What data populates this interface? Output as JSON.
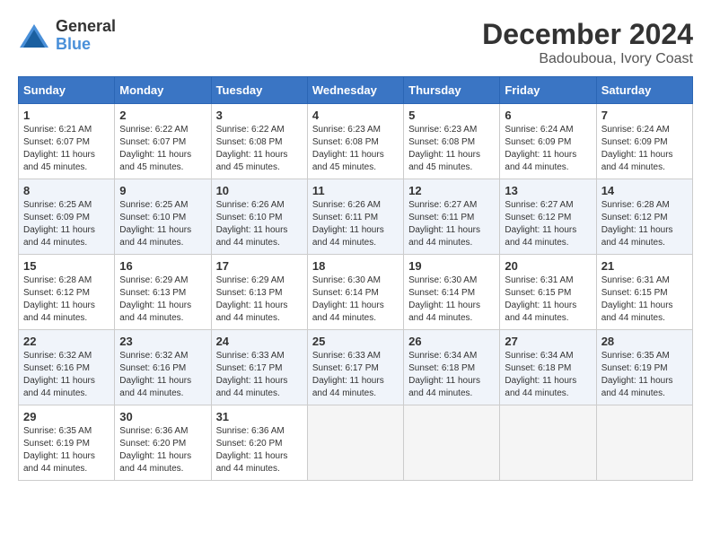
{
  "header": {
    "logo_general": "General",
    "logo_blue": "Blue",
    "month_title": "December 2024",
    "location": "Badouboua, Ivory Coast"
  },
  "days_of_week": [
    "Sunday",
    "Monday",
    "Tuesday",
    "Wednesday",
    "Thursday",
    "Friday",
    "Saturday"
  ],
  "weeks": [
    [
      {
        "day": "1",
        "sunrise": "6:21 AM",
        "sunset": "6:07 PM",
        "daylight": "11 hours and 45 minutes."
      },
      {
        "day": "2",
        "sunrise": "6:22 AM",
        "sunset": "6:07 PM",
        "daylight": "11 hours and 45 minutes."
      },
      {
        "day": "3",
        "sunrise": "6:22 AM",
        "sunset": "6:08 PM",
        "daylight": "11 hours and 45 minutes."
      },
      {
        "day": "4",
        "sunrise": "6:23 AM",
        "sunset": "6:08 PM",
        "daylight": "11 hours and 45 minutes."
      },
      {
        "day": "5",
        "sunrise": "6:23 AM",
        "sunset": "6:08 PM",
        "daylight": "11 hours and 45 minutes."
      },
      {
        "day": "6",
        "sunrise": "6:24 AM",
        "sunset": "6:09 PM",
        "daylight": "11 hours and 44 minutes."
      },
      {
        "day": "7",
        "sunrise": "6:24 AM",
        "sunset": "6:09 PM",
        "daylight": "11 hours and 44 minutes."
      }
    ],
    [
      {
        "day": "8",
        "sunrise": "6:25 AM",
        "sunset": "6:09 PM",
        "daylight": "11 hours and 44 minutes."
      },
      {
        "day": "9",
        "sunrise": "6:25 AM",
        "sunset": "6:10 PM",
        "daylight": "11 hours and 44 minutes."
      },
      {
        "day": "10",
        "sunrise": "6:26 AM",
        "sunset": "6:10 PM",
        "daylight": "11 hours and 44 minutes."
      },
      {
        "day": "11",
        "sunrise": "6:26 AM",
        "sunset": "6:11 PM",
        "daylight": "11 hours and 44 minutes."
      },
      {
        "day": "12",
        "sunrise": "6:27 AM",
        "sunset": "6:11 PM",
        "daylight": "11 hours and 44 minutes."
      },
      {
        "day": "13",
        "sunrise": "6:27 AM",
        "sunset": "6:12 PM",
        "daylight": "11 hours and 44 minutes."
      },
      {
        "day": "14",
        "sunrise": "6:28 AM",
        "sunset": "6:12 PM",
        "daylight": "11 hours and 44 minutes."
      }
    ],
    [
      {
        "day": "15",
        "sunrise": "6:28 AM",
        "sunset": "6:12 PM",
        "daylight": "11 hours and 44 minutes."
      },
      {
        "day": "16",
        "sunrise": "6:29 AM",
        "sunset": "6:13 PM",
        "daylight": "11 hours and 44 minutes."
      },
      {
        "day": "17",
        "sunrise": "6:29 AM",
        "sunset": "6:13 PM",
        "daylight": "11 hours and 44 minutes."
      },
      {
        "day": "18",
        "sunrise": "6:30 AM",
        "sunset": "6:14 PM",
        "daylight": "11 hours and 44 minutes."
      },
      {
        "day": "19",
        "sunrise": "6:30 AM",
        "sunset": "6:14 PM",
        "daylight": "11 hours and 44 minutes."
      },
      {
        "day": "20",
        "sunrise": "6:31 AM",
        "sunset": "6:15 PM",
        "daylight": "11 hours and 44 minutes."
      },
      {
        "day": "21",
        "sunrise": "6:31 AM",
        "sunset": "6:15 PM",
        "daylight": "11 hours and 44 minutes."
      }
    ],
    [
      {
        "day": "22",
        "sunrise": "6:32 AM",
        "sunset": "6:16 PM",
        "daylight": "11 hours and 44 minutes."
      },
      {
        "day": "23",
        "sunrise": "6:32 AM",
        "sunset": "6:16 PM",
        "daylight": "11 hours and 44 minutes."
      },
      {
        "day": "24",
        "sunrise": "6:33 AM",
        "sunset": "6:17 PM",
        "daylight": "11 hours and 44 minutes."
      },
      {
        "day": "25",
        "sunrise": "6:33 AM",
        "sunset": "6:17 PM",
        "daylight": "11 hours and 44 minutes."
      },
      {
        "day": "26",
        "sunrise": "6:34 AM",
        "sunset": "6:18 PM",
        "daylight": "11 hours and 44 minutes."
      },
      {
        "day": "27",
        "sunrise": "6:34 AM",
        "sunset": "6:18 PM",
        "daylight": "11 hours and 44 minutes."
      },
      {
        "day": "28",
        "sunrise": "6:35 AM",
        "sunset": "6:19 PM",
        "daylight": "11 hours and 44 minutes."
      }
    ],
    [
      {
        "day": "29",
        "sunrise": "6:35 AM",
        "sunset": "6:19 PM",
        "daylight": "11 hours and 44 minutes."
      },
      {
        "day": "30",
        "sunrise": "6:36 AM",
        "sunset": "6:20 PM",
        "daylight": "11 hours and 44 minutes."
      },
      {
        "day": "31",
        "sunrise": "6:36 AM",
        "sunset": "6:20 PM",
        "daylight": "11 hours and 44 minutes."
      },
      null,
      null,
      null,
      null
    ]
  ],
  "labels": {
    "sunrise": "Sunrise: ",
    "sunset": "Sunset: ",
    "daylight": "Daylight: "
  }
}
